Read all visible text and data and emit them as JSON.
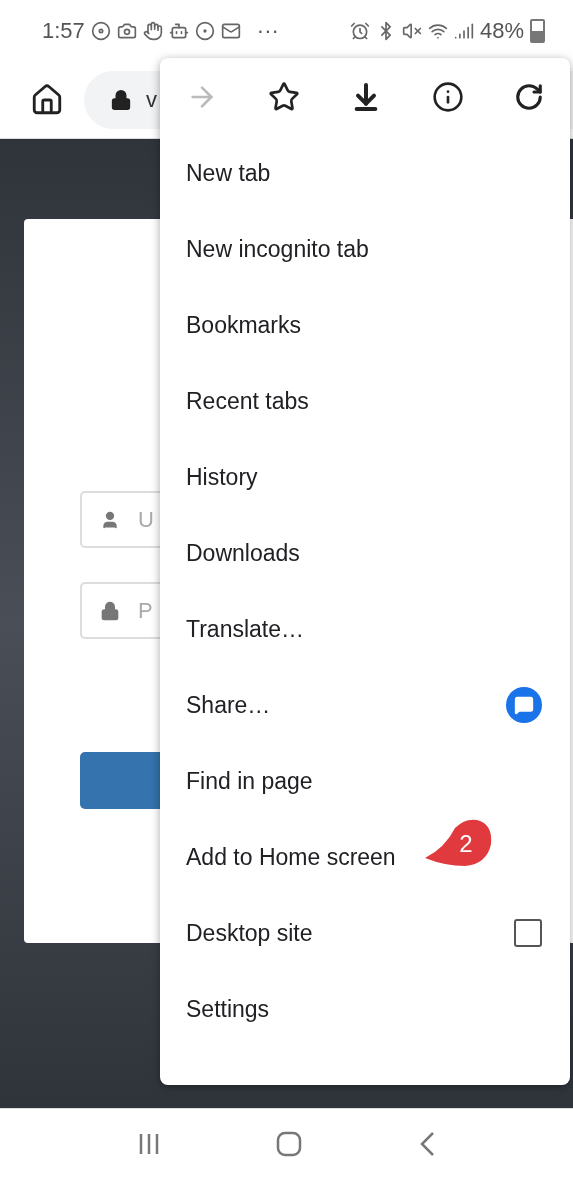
{
  "status_bar": {
    "time": "1:57",
    "more": "···",
    "battery": "48%"
  },
  "toolbar": {
    "url": "v"
  },
  "login": {
    "username_placeholder": "U",
    "password_placeholder": "P"
  },
  "menu": {
    "forward_disabled": true,
    "items": [
      {
        "label": "New tab",
        "kind": "plain"
      },
      {
        "label": "New incognito tab",
        "kind": "plain"
      },
      {
        "label": "Bookmarks",
        "kind": "plain"
      },
      {
        "label": "Recent tabs",
        "kind": "plain"
      },
      {
        "label": "History",
        "kind": "plain"
      },
      {
        "label": "Downloads",
        "kind": "plain"
      },
      {
        "label": "Translate…",
        "kind": "plain"
      },
      {
        "label": "Share…",
        "kind": "share"
      },
      {
        "label": "Find in page",
        "kind": "plain"
      },
      {
        "label": "Add to Home screen",
        "kind": "plain"
      },
      {
        "label": "Desktop site",
        "kind": "checkbox",
        "checked": false
      },
      {
        "label": "Settings",
        "kind": "plain"
      }
    ]
  },
  "callout": {
    "text": "2"
  }
}
